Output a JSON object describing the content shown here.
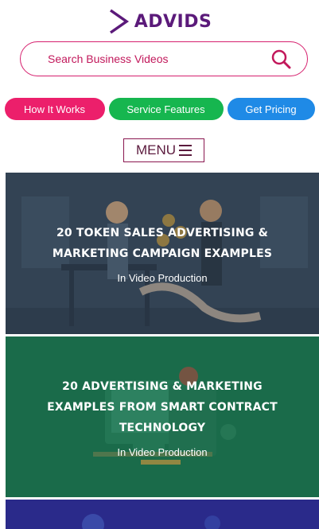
{
  "logo": {
    "text": "ADVIDS",
    "icon": "chevron-right-icon",
    "color": "#5b1a7a"
  },
  "search": {
    "placeholder": "Search Business Videos",
    "icon": "search-icon",
    "accent": "#d6206e"
  },
  "nav_pills": [
    {
      "label": "How It Works",
      "color": "#ec1f6b"
    },
    {
      "label": "Service Features",
      "color": "#16b64f"
    },
    {
      "label": "Get Pricing",
      "color": "#1f8ae6"
    }
  ],
  "menu": {
    "label": "MENU",
    "icon": "hamburger-icon"
  },
  "articles": [
    {
      "title": "20 TOKEN SALES ADVERTISING & MARKETING CAMPAIGN EXAMPLES",
      "category": "In Video Production",
      "bg_color": "#3f5266"
    },
    {
      "title": "20 ADVERTISING & MARKETING EXAMPLES FROM SMART CONTRACT TECHNOLOGY",
      "category": "In Video Production",
      "bg_color": "#1f7a55"
    },
    {
      "title": "",
      "category": "",
      "bg_color": "#2a2a8a"
    }
  ]
}
